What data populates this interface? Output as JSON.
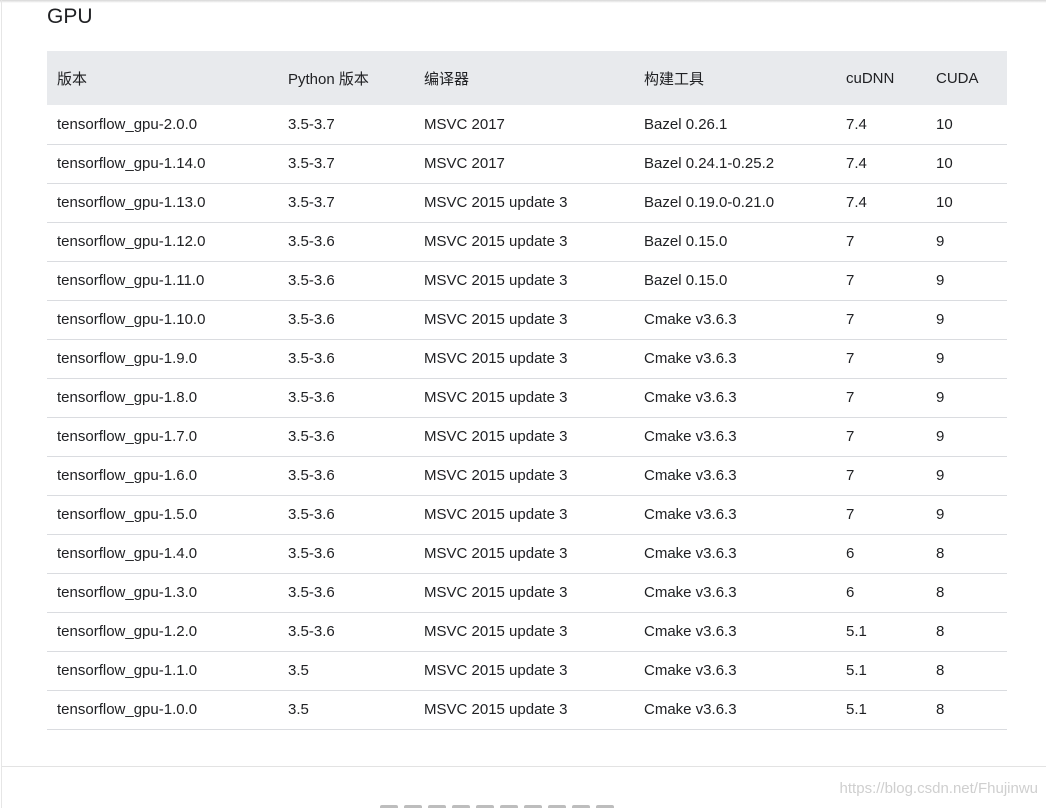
{
  "section": {
    "title": "GPU"
  },
  "table": {
    "headers": [
      "版本",
      "Python 版本",
      "编译器",
      "构建工具",
      "cuDNN",
      "CUDA"
    ],
    "rows": [
      [
        "tensorflow_gpu-2.0.0",
        "3.5-3.7",
        "MSVC 2017",
        "Bazel 0.26.1",
        "7.4",
        "10"
      ],
      [
        "tensorflow_gpu-1.14.0",
        "3.5-3.7",
        "MSVC 2017",
        "Bazel 0.24.1-0.25.2",
        "7.4",
        "10"
      ],
      [
        "tensorflow_gpu-1.13.0",
        "3.5-3.7",
        "MSVC 2015 update 3",
        "Bazel 0.19.0-0.21.0",
        "7.4",
        "10"
      ],
      [
        "tensorflow_gpu-1.12.0",
        "3.5-3.6",
        "MSVC 2015 update 3",
        "Bazel 0.15.0",
        "7",
        "9"
      ],
      [
        "tensorflow_gpu-1.11.0",
        "3.5-3.6",
        "MSVC 2015 update 3",
        "Bazel 0.15.0",
        "7",
        "9"
      ],
      [
        "tensorflow_gpu-1.10.0",
        "3.5-3.6",
        "MSVC 2015 update 3",
        "Cmake v3.6.3",
        "7",
        "9"
      ],
      [
        "tensorflow_gpu-1.9.0",
        "3.5-3.6",
        "MSVC 2015 update 3",
        "Cmake v3.6.3",
        "7",
        "9"
      ],
      [
        "tensorflow_gpu-1.8.0",
        "3.5-3.6",
        "MSVC 2015 update 3",
        "Cmake v3.6.3",
        "7",
        "9"
      ],
      [
        "tensorflow_gpu-1.7.0",
        "3.5-3.6",
        "MSVC 2015 update 3",
        "Cmake v3.6.3",
        "7",
        "9"
      ],
      [
        "tensorflow_gpu-1.6.0",
        "3.5-3.6",
        "MSVC 2015 update 3",
        "Cmake v3.6.3",
        "7",
        "9"
      ],
      [
        "tensorflow_gpu-1.5.0",
        "3.5-3.6",
        "MSVC 2015 update 3",
        "Cmake v3.6.3",
        "7",
        "9"
      ],
      [
        "tensorflow_gpu-1.4.0",
        "3.5-3.6",
        "MSVC 2015 update 3",
        "Cmake v3.6.3",
        "6",
        "8"
      ],
      [
        "tensorflow_gpu-1.3.0",
        "3.5-3.6",
        "MSVC 2015 update 3",
        "Cmake v3.6.3",
        "6",
        "8"
      ],
      [
        "tensorflow_gpu-1.2.0",
        "3.5-3.6",
        "MSVC 2015 update 3",
        "Cmake v3.6.3",
        "5.1",
        "8"
      ],
      [
        "tensorflow_gpu-1.1.0",
        "3.5",
        "MSVC 2015 update 3",
        "Cmake v3.6.3",
        "5.1",
        "8"
      ],
      [
        "tensorflow_gpu-1.0.0",
        "3.5",
        "MSVC 2015 update 3",
        "Cmake v3.6.3",
        "5.1",
        "8"
      ]
    ]
  },
  "watermark": "https://blog.csdn.net/Fhujinwu",
  "colors": {
    "header_bg": "#e8eaed",
    "row_border": "#dadce0",
    "text": "#202124",
    "watermark": "#cfcfcf"
  }
}
